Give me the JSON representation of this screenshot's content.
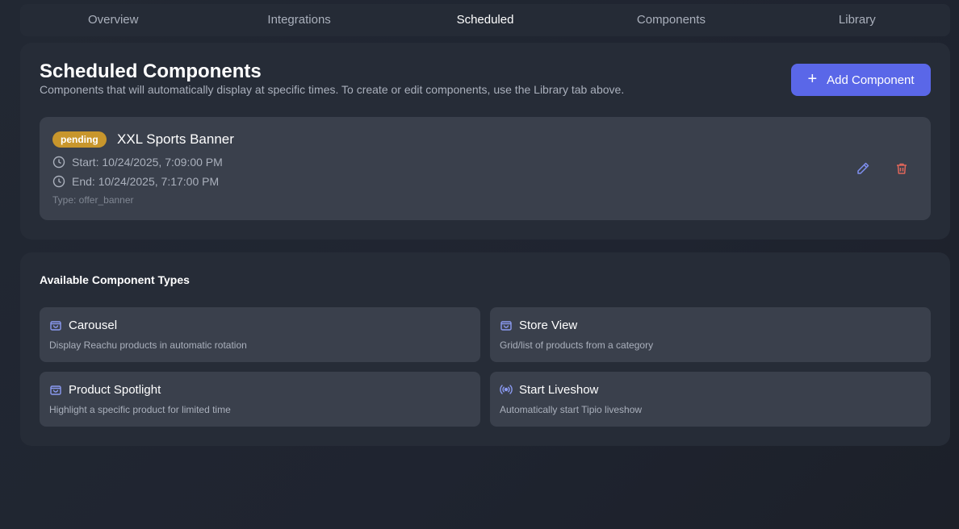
{
  "tabs": [
    {
      "label": "Overview"
    },
    {
      "label": "Integrations"
    },
    {
      "label": "Scheduled"
    },
    {
      "label": "Components"
    },
    {
      "label": "Library"
    }
  ],
  "active_tab": "Scheduled",
  "scheduled": {
    "title": "Scheduled Components",
    "subtitle": "Components that will automatically display at specific times. To create or edit components, use the Library tab above.",
    "add_button_label": "Add Component",
    "items": [
      {
        "status": "pending",
        "name": "XXL Sports Banner",
        "start": "Start: 10/24/2025, 7:09:00 PM",
        "end": "End: 10/24/2025, 7:17:00 PM",
        "type": "Type: offer_banner"
      }
    ]
  },
  "types": {
    "title": "Available Component Types",
    "items": [
      {
        "icon": "shopping-bag-icon",
        "name": "Carousel",
        "description": "Display Reachu products in automatic rotation"
      },
      {
        "icon": "shopping-bag-icon",
        "name": "Store View",
        "description": "Grid/list of products from a category"
      },
      {
        "icon": "shopping-bag-icon",
        "name": "Product Spotlight",
        "description": "Highlight a specific product for limited time"
      },
      {
        "icon": "broadcast-icon",
        "name": "Start Liveshow",
        "description": "Automatically start Tipio liveshow"
      }
    ]
  },
  "colors": {
    "accent": "#5a67e8",
    "pending": "#c8962c",
    "edit_icon": "#7f8ff0",
    "delete_icon": "#e0665a",
    "type_icon": "#8b9af2"
  }
}
